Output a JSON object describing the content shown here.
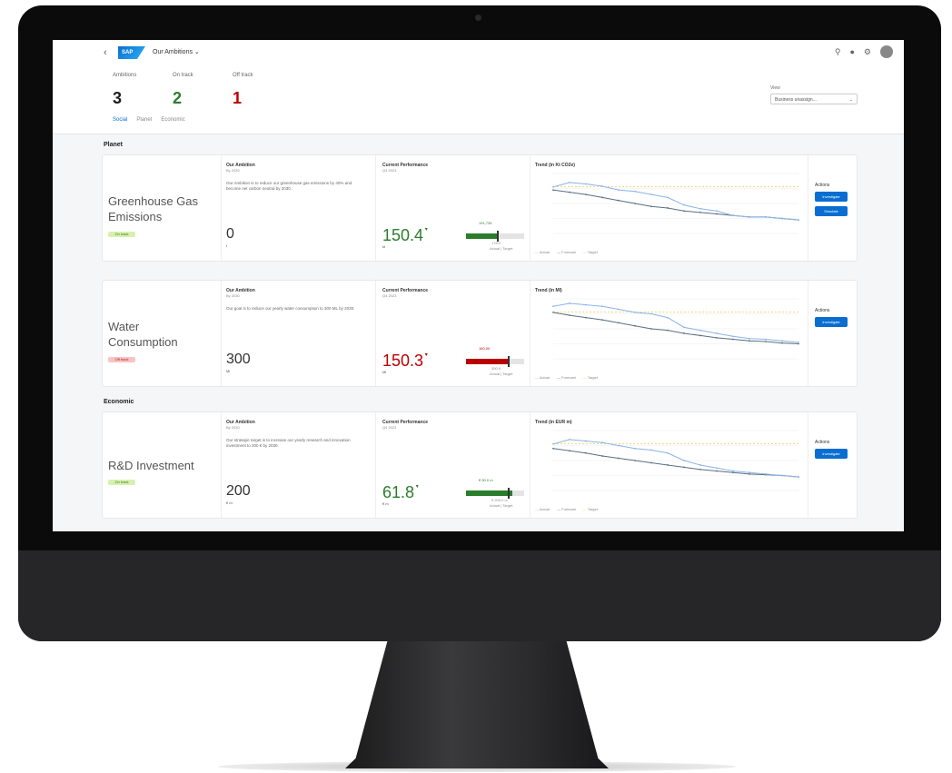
{
  "app": {
    "back": "‹",
    "logo": "SAP",
    "title": "Our Ambitions ⌄"
  },
  "shell_icons": [
    "search-icon",
    "bell-icon",
    "gear-icon",
    "user-avatar"
  ],
  "header": {
    "kpis": [
      {
        "label": "Ambitions",
        "value": "3",
        "color": "#1d1d1d"
      },
      {
        "label": "On track",
        "value": "2",
        "color": "#2b7d2b"
      },
      {
        "label": "Off track",
        "value": "1",
        "color": "#bb0000"
      }
    ],
    "tabs": [
      "Social",
      "Planet",
      "Economic"
    ],
    "filter_label": "View",
    "filter_value": "Business unassign..."
  },
  "sections": {
    "planet": "Planet",
    "economic": "Economic"
  },
  "cards": [
    {
      "name_line1": "Greenhouse Gas",
      "name_line2": "Emissions",
      "status": "On track",
      "goal_title": "Our Ambition",
      "goal_sub": "By 2030",
      "goal_desc": "Our Ambition is to reduce our greenhouse gas emissions by 40% and become net carbon neutral by 2030.",
      "goal_value": "0",
      "goal_unit": "t",
      "perf_title": "Current Performance",
      "perf_sub": "Q4 2023",
      "perf_value": "150.4",
      "perf_unit": "kt",
      "perf_color": "#2b7d2b",
      "bullet_label": "191,735",
      "bullet_sub": "178.0",
      "bullet_legend": "Actual | Target",
      "bullet_fill": 0.55,
      "trend_title": "Trend (in Kt CO2e)",
      "legend": [
        "Actual",
        "Forecast",
        "Target"
      ],
      "actions_label": "Actions",
      "buttons": [
        "Investigate",
        "Simulate"
      ]
    },
    {
      "name_line1": "Water",
      "name_line2": "Consumption",
      "status": "Off track",
      "goal_title": "Our Ambition",
      "goal_sub": "By 2030",
      "goal_desc": "Our goal is to reduce our yearly water consumption to 300 ML by 2030.",
      "goal_value": "300",
      "goal_unit": "Ml",
      "perf_title": "Current Performance",
      "perf_sub": "Q4 2023",
      "perf_value": "150.3",
      "perf_unit": "Ml",
      "perf_color": "#bb0000",
      "bullet_label": "160.00",
      "bullet_sub": "300.0",
      "bullet_legend": "Actual | Target",
      "bullet_fill": 0.72,
      "trend_title": "Trend (in Ml)",
      "legend": [
        "Actual",
        "Forecast",
        "Target"
      ],
      "actions_label": "Actions",
      "buttons": [
        "Investigate"
      ]
    },
    {
      "name_line1": "R&D Investment",
      "name_line2": "",
      "status": "On track",
      "goal_title": "Our Ambition",
      "goal_sub": "By 2030",
      "goal_desc": "Our strategic target is to increase our yearly research and innovation investment to 200 € by 2030.",
      "goal_value": "200",
      "goal_unit": "€ m",
      "perf_title": "Current Performance",
      "perf_sub": "Q4 2023",
      "perf_value": "61.8",
      "perf_unit": "€ m",
      "perf_color": "#2b7d2b",
      "bullet_label": "€ 90.0 m",
      "bullet_sub": "€ 200.0 m",
      "bullet_legend": "Actual | Target",
      "bullet_fill": 0.8,
      "trend_title": "Trend (in EUR m)",
      "legend": [
        "Actual",
        "Forecast",
        "Target"
      ],
      "actions_label": "Actions",
      "buttons": [
        "Investigate"
      ]
    }
  ],
  "colors": {
    "accent": "#0a6ed1",
    "actual": "#8ab4e8",
    "forecast": "#5a6e80",
    "target": "#f0c040"
  }
}
